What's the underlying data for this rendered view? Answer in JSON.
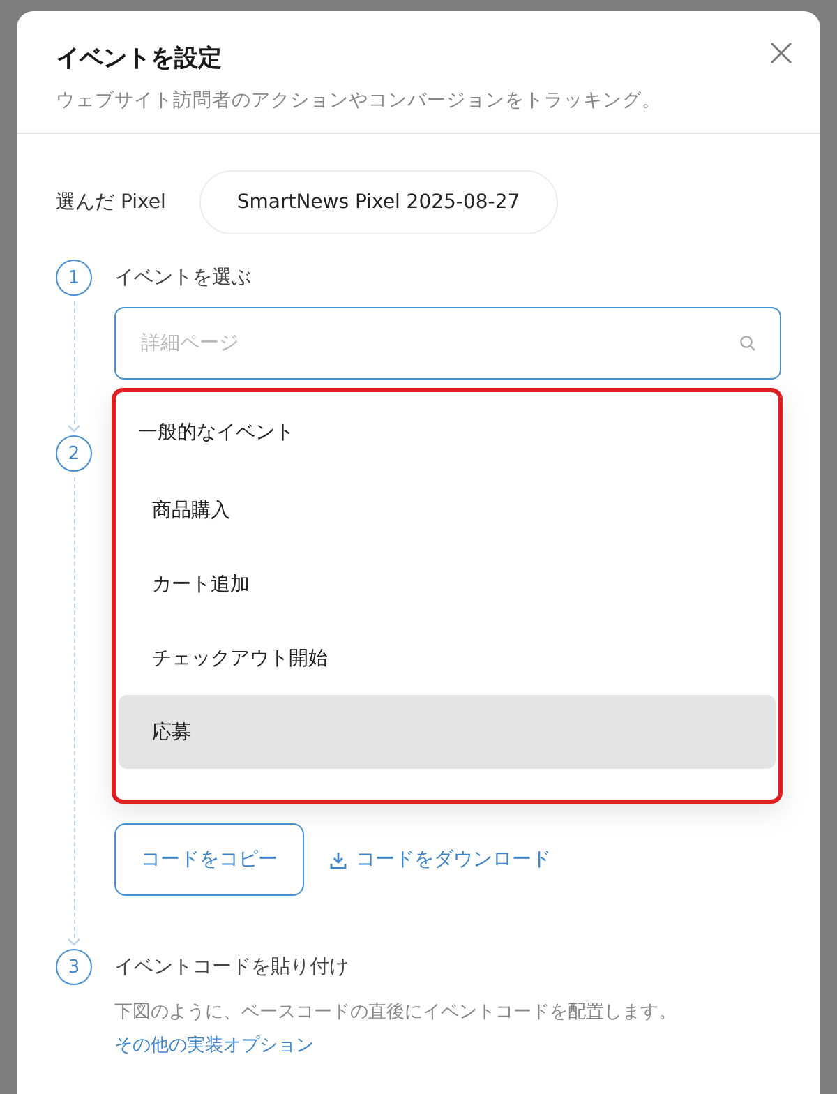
{
  "dialog": {
    "title": "イベントを設定",
    "subtitle": "ウェブサイト訪問者のアクションやコンバージョンをトラッキング。"
  },
  "pixel": {
    "label": "選んだ Pixel",
    "value": "SmartNews Pixel 2025-08-27"
  },
  "steps": [
    {
      "number": "1",
      "title": "イベントを選ぶ"
    },
    {
      "number": "2"
    },
    {
      "number": "3",
      "title": "イベントコードを貼り付け"
    }
  ],
  "search": {
    "placeholder": "詳細ページ"
  },
  "dropdown": {
    "group": "一般的なイベント",
    "options": [
      {
        "label": "商品購入",
        "selected": false
      },
      {
        "label": "カート追加",
        "selected": false
      },
      {
        "label": "チェックアウト開始",
        "selected": false
      },
      {
        "label": "応募",
        "selected": true
      }
    ]
  },
  "actions": {
    "copy": "コードをコピー",
    "download": "コードをダウンロード"
  },
  "instructions": {
    "text": "下図のように、ベースコードの直後にイベントコードを配置します。",
    "link": "その他の実装オプション"
  }
}
